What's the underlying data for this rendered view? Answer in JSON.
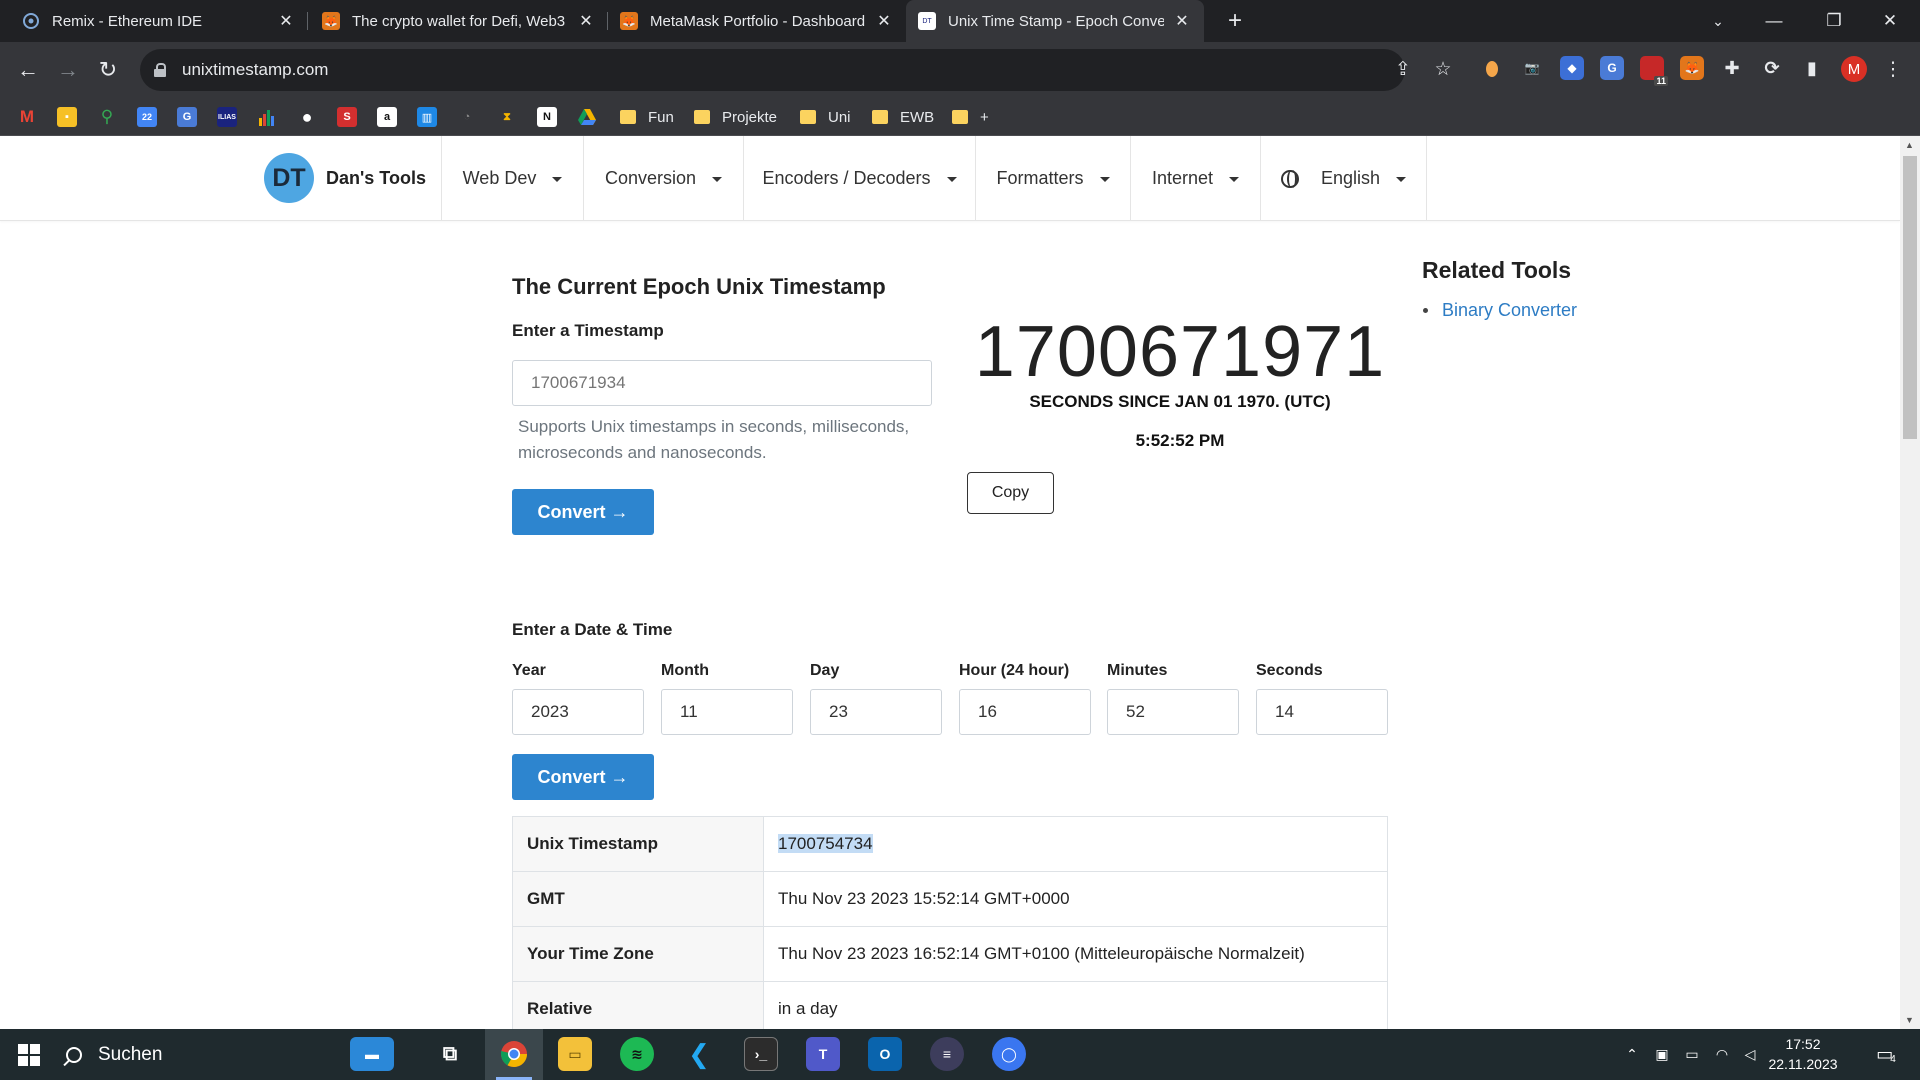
{
  "browser": {
    "tabs": [
      {
        "title": "Remix - Ethereum IDE",
        "icon": "remix-icon",
        "active": false
      },
      {
        "title": "The crypto wallet for Defi, Web3",
        "icon": "metamask-fox-icon",
        "active": false
      },
      {
        "title": "MetaMask Portfolio - Dashboard",
        "icon": "metamask-fox-icon",
        "active": false
      },
      {
        "title": "Unix Time Stamp - Epoch Conve",
        "icon": "dans-tools-icon",
        "active": true
      }
    ],
    "url": "unixtimestamp.com",
    "bookmark_folders": [
      "Fun",
      "Projekte",
      "Uni",
      "EWB"
    ],
    "bookmark_add": "+",
    "profile_initial": "M",
    "ext_badge": "11"
  },
  "site": {
    "logo_initials": "DT",
    "brand": "Dan's Tools",
    "nav": [
      "Web Dev",
      "Conversion",
      "Encoders / Decoders",
      "Formatters",
      "Internet",
      "English"
    ]
  },
  "epoch": {
    "heading": "The Current Epoch Unix Timestamp",
    "input_label": "Enter a Timestamp",
    "input_placeholder": "1700671934",
    "help": "Supports Unix timestamps in seconds, milliseconds, microseconds and nanoseconds.",
    "convert_label": "Convert →",
    "current": "1700671971",
    "current_sub": "SECONDS SINCE JAN 01 1970. (UTC)",
    "current_time": "5:52:52 PM",
    "copy_label": "Copy"
  },
  "related": {
    "title": "Related Tools",
    "items": [
      "Binary Converter"
    ]
  },
  "datetime": {
    "heading": "Enter a Date & Time",
    "fields": [
      {
        "label": "Year",
        "value": "2023"
      },
      {
        "label": "Month",
        "value": "11"
      },
      {
        "label": "Day",
        "value": "23"
      },
      {
        "label": "Hour (24 hour)",
        "value": "16"
      },
      {
        "label": "Minutes",
        "value": "52"
      },
      {
        "label": "Seconds",
        "value": "14"
      }
    ],
    "convert_label": "Convert →"
  },
  "result": {
    "rows": [
      {
        "key": "Unix Timestamp",
        "value": "1700754734"
      },
      {
        "key": "GMT",
        "value": "Thu Nov 23 2023 15:52:14 GMT+0000"
      },
      {
        "key": "Your Time Zone",
        "value": "Thu Nov 23 2023 16:52:14 GMT+0100 (Mitteleuropäische Normalzeit)"
      },
      {
        "key": "Relative",
        "value": "in a day"
      }
    ]
  },
  "taskbar": {
    "search_label": "Suchen",
    "time": "17:52",
    "date": "22.11.2023",
    "notification_count": "4"
  },
  "colors": {
    "primary": "#2d85cf",
    "link": "#2d7cc4",
    "logo": "#4ea6e2"
  }
}
